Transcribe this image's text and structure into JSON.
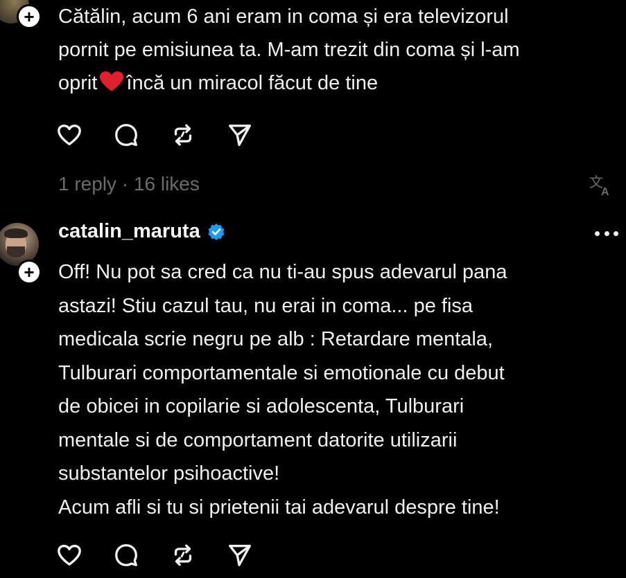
{
  "comment_top": {
    "text_before_heart": "Cătălin, acum 6 ani eram in coma și era televizorul\npornit pe emisiunea ta. M-am trezit din coma și l-am\noprit",
    "text_after_heart": "încă un miracol făcut de tine",
    "replies": "1 reply",
    "separator": "·",
    "likes": "16 likes"
  },
  "reply": {
    "username": "catalin_maruta",
    "text": "Off! Nu pot sa cred ca nu ti-au spus adevarul pana\nastazi! Stiu cazul tau, nu erai in coma... pe fisa\nmedicala scrie negru pe alb : Retardare mentala,\nTulburari comportamentale si emotionale cu debut\nde obicei in copilarie si adolescenta, Tulburari\nmentale si de comportament datorite utilizarii\nsubstantelor psihoactive!\nAcum afli si tu si prietenii tai adevarul despre tine!"
  },
  "icons": {
    "like": "heart-icon",
    "comment": "comment-bubble-icon",
    "repost": "repost-icon",
    "share": "send-icon",
    "translate": "translate-icon",
    "more": "more-options-icon",
    "verified": "verified-badge-icon",
    "follow": "plus-icon"
  },
  "colors": {
    "background": "#000000",
    "text": "#f0f0f0",
    "meta": "#6b6b6b",
    "verified": "#1d9bf0",
    "heart": "#e0202e"
  }
}
